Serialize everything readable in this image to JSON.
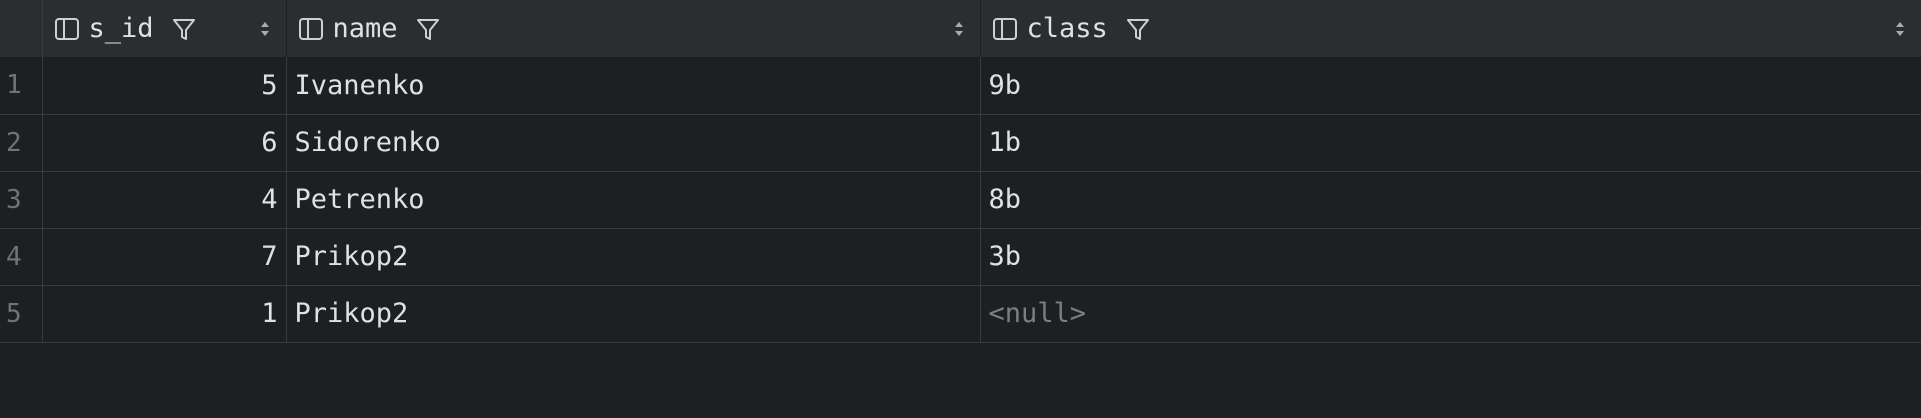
{
  "columns": [
    {
      "label": "s_id"
    },
    {
      "label": "name"
    },
    {
      "label": "class"
    }
  ],
  "rows": [
    {
      "num": "1",
      "s_id": "5",
      "name": "Ivanenko",
      "class": "9b"
    },
    {
      "num": "2",
      "s_id": "6",
      "name": "Sidorenko",
      "class": "1b"
    },
    {
      "num": "3",
      "s_id": "4",
      "name": "Petrenko",
      "class": "8b"
    },
    {
      "num": "4",
      "s_id": "7",
      "name": "Prikop2",
      "class": "3b"
    },
    {
      "num": "5",
      "s_id": "1",
      "name": "Prikop2",
      "class": "<null>"
    }
  ],
  "colors": {
    "background": "#1e1f22",
    "header_background": "#2b2d30",
    "text": "#dfe1e5",
    "muted_text": "#6f737a",
    "null_text": "#7a7e85",
    "grid_line": "#393b40"
  },
  "icons": [
    "column-icon",
    "filter-icon",
    "sort-icon"
  ]
}
